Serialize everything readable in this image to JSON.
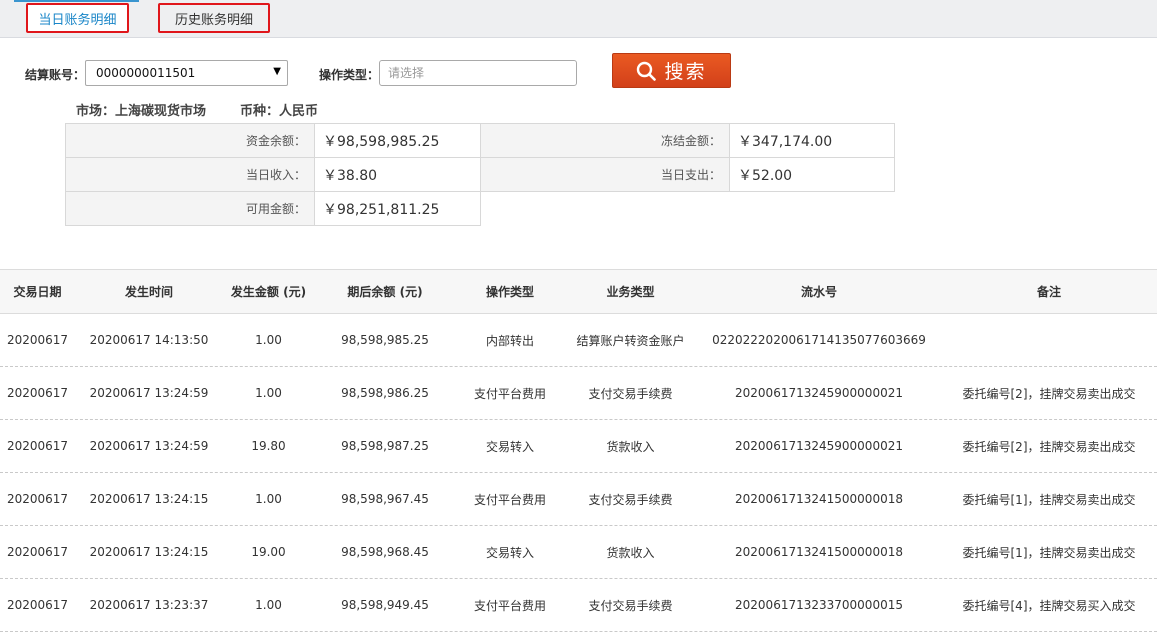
{
  "tabs": [
    {
      "label": "当日账务明细",
      "active": true
    },
    {
      "label": "历史账务明细",
      "active": false
    }
  ],
  "filters": {
    "account_label": "结算账号：",
    "account_value": "0000000011501",
    "op_type_label": "操作类型：",
    "op_type_placeholder": "请选择",
    "search_label": "搜索"
  },
  "info": {
    "market": "市场：上海碳现货市场",
    "currency": "币种：人民币"
  },
  "summary": {
    "balance_label": "资金余额：",
    "balance_value": "￥98,598,985.25",
    "frozen_label": "冻结金额：",
    "frozen_value": "￥347,174.00",
    "income_label": "当日收入：",
    "income_value": "￥38.80",
    "expense_label": "当日支出：",
    "expense_value": "￥52.00",
    "available_label": "可用金额：",
    "available_value": "￥98,251,811.25"
  },
  "table": {
    "headers": [
      "交易日期",
      "发生时间",
      "发生金额 (元)",
      "期后余额 (元)",
      "操作类型",
      "业务类型",
      "流水号",
      "备注"
    ],
    "rows": [
      [
        "20200617",
        "20200617 14:13:50",
        "1.00",
        "98,598,985.25",
        "内部转出",
        "结算账户转资金账户",
        "02202220200617141350776036​69",
        ""
      ],
      [
        "20200617",
        "20200617 13:24:59",
        "1.00",
        "98,598,986.25",
        "支付平台费用",
        "支付交易手续费",
        "2020061713245900000021",
        "委托编号[2]，挂牌交易卖出成交"
      ],
      [
        "20200617",
        "20200617 13:24:59",
        "19.80",
        "98,598,987.25",
        "交易转入",
        "货款收入",
        "2020061713245900000021",
        "委托编号[2]，挂牌交易卖出成交"
      ],
      [
        "20200617",
        "20200617 13:24:15",
        "1.00",
        "98,598,967.45",
        "支付平台费用",
        "支付交易手续费",
        "2020061713241500000018",
        "委托编号[1]，挂牌交易卖出成交"
      ],
      [
        "20200617",
        "20200617 13:24:15",
        "19.00",
        "98,598,968.45",
        "交易转入",
        "货款收入",
        "2020061713241500000018",
        "委托编号[1]，挂牌交易卖出成交"
      ],
      [
        "20200617",
        "20200617 13:23:37",
        "1.00",
        "98,598,949.45",
        "支付平台费用",
        "支付交易手续费",
        "2020061713233700000015",
        "委托编号[4]，挂牌交易买入成交"
      ]
    ]
  },
  "colors": {
    "accent": "#1a86c8",
    "search_button": "#de4b1e",
    "highlight_border": "#e0161b"
  },
  "icons": {
    "search": "magnifier-icon",
    "dropdown": "triangle-down-icon"
  }
}
